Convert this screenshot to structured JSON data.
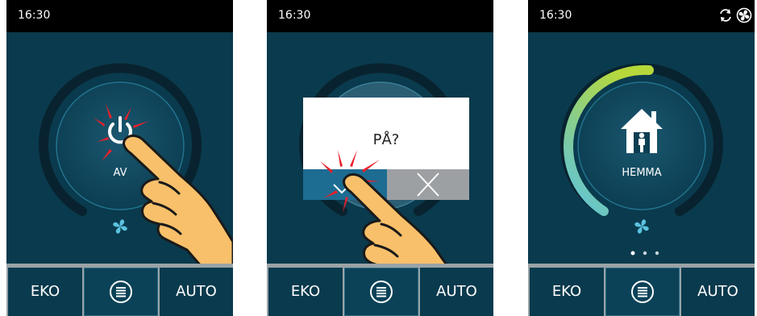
{
  "screens": [
    {
      "time": "16:30",
      "power_label": "AV",
      "bottom": {
        "left": "EKO",
        "right": "AUTO"
      }
    },
    {
      "time": "16:30",
      "dialog": {
        "question": "PÅ?"
      },
      "bottom": {
        "left": "EKO",
        "right": "AUTO"
      }
    },
    {
      "time": "16:30",
      "mode_label": "HEMMA",
      "page_indicator": {
        "total": 3,
        "active": 1
      },
      "bottom": {
        "left": "EKO",
        "right": "AUTO"
      }
    }
  ],
  "colors": {
    "background": "#0a3a4d",
    "status_bar": "#000000",
    "arc_gradient": [
      "#5bc3e0",
      "#b6d83b"
    ],
    "dialog_yes": "#1d6c92",
    "dialog_no": "#9ca0a3",
    "tap_burst": "#e8202a",
    "hand": "#f8c06a"
  },
  "icons": {
    "power": "power-icon",
    "fan": "fan-icon",
    "home": "home-icon",
    "menu": "menu-icon",
    "sync": "sync-icon",
    "fan_status": "fan-status-icon",
    "check": "check-icon",
    "close": "close-icon"
  }
}
